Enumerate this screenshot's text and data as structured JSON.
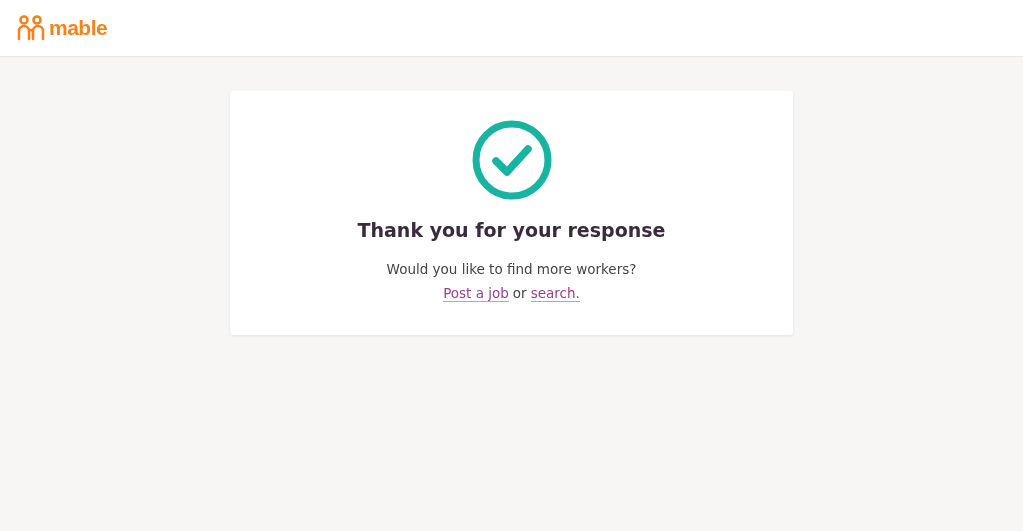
{
  "header": {
    "logo_text": "mable"
  },
  "card": {
    "title": "Thank you for your response",
    "question": "Would you like to find more workers?",
    "links": [
      {
        "label": "Post a job"
      },
      {
        "label": "search."
      }
    ],
    "connector": "or"
  }
}
